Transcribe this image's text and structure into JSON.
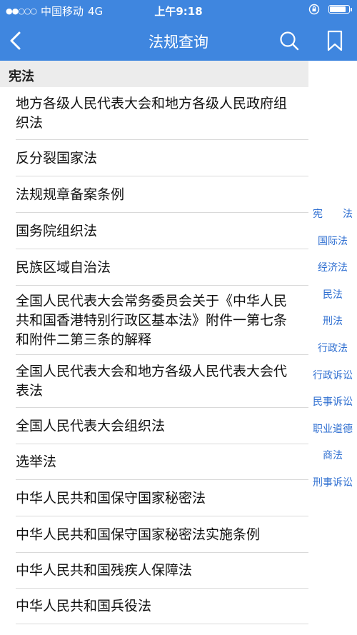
{
  "status_bar": {
    "signal": "●●○○○",
    "carrier": "中国移动",
    "network": "4G",
    "time": "上午9:18",
    "battery_level": 0.9
  },
  "nav": {
    "title": "法规查询",
    "back_icon": "chevron-left-icon",
    "search_icon": "search-icon",
    "bookmark_icon": "bookmark-icon"
  },
  "section": {
    "title": "宪法"
  },
  "laws": [
    "地方各级人民代表大会和地方各级人民政府组织法",
    "反分裂国家法",
    "法规规章备案条例",
    "国务院组织法",
    "民族区域自治法",
    "全国人民代表大会常务委员会关于《中华人民共和国香港特别行政区基本法》附件一第七条和附件二第三条的解释",
    "全国人民代表大会和地方各级人民代表大会代表法",
    "全国人民代表大会组织法",
    "选举法",
    "中华人民共和国保守国家秘密法",
    "中华人民共和国保守国家秘密法实施条例",
    "中华人民共和国残疾人保障法",
    "中华人民共和国兵役法"
  ],
  "index": [
    "宪　　法",
    "国际法",
    "经济法",
    "民法",
    "刑法",
    "行政法",
    "行政诉讼",
    "民事诉讼",
    "职业道德",
    "商法",
    "刑事诉讼"
  ],
  "colors": {
    "accent": "#3f86df",
    "index_text": "#2f6fd1",
    "section_bg": "#ececec"
  }
}
